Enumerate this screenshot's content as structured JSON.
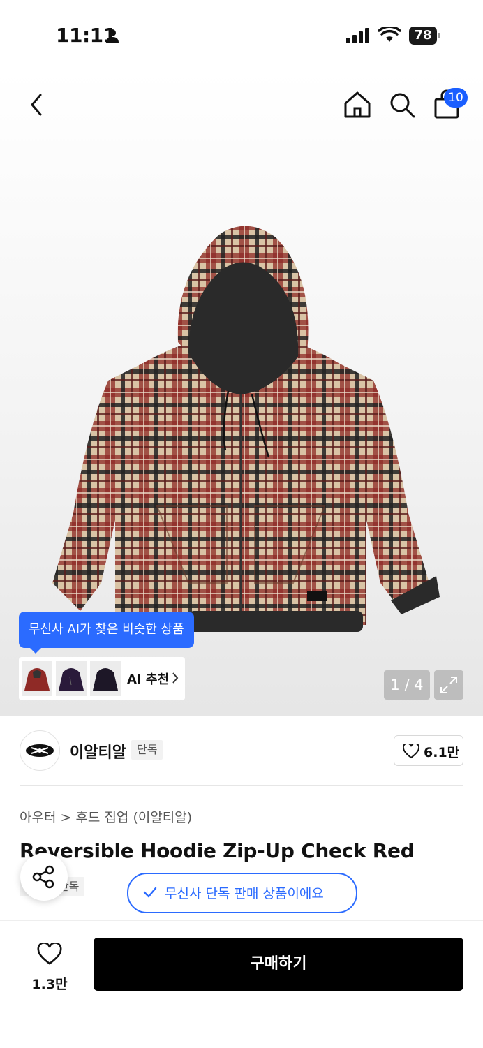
{
  "status_bar": {
    "time": "11:11",
    "battery": "78"
  },
  "nav": {
    "cart_count": "10"
  },
  "gallery": {
    "ai_tooltip": "무신사 AI가 찾은 비슷한 상품",
    "ai_label": "AI 추천",
    "pager": "1 / 4"
  },
  "brand": {
    "name": "이알티알",
    "tag": "단독",
    "likes": "6.1만"
  },
  "product": {
    "breadcrumb": "아우터 > 후드 집업 (이알티알)",
    "title": "Reversible Hoodie Zip-Up Check Red",
    "tag": "단독",
    "exclusive_notice": "무신사 단독 판매 상품이에요"
  },
  "bottom": {
    "likes": "1.3만",
    "buy_label": "구매하기"
  },
  "colors": {
    "accent": "#2b6bff",
    "badge": "#1a5eff",
    "buy": "#000000"
  }
}
